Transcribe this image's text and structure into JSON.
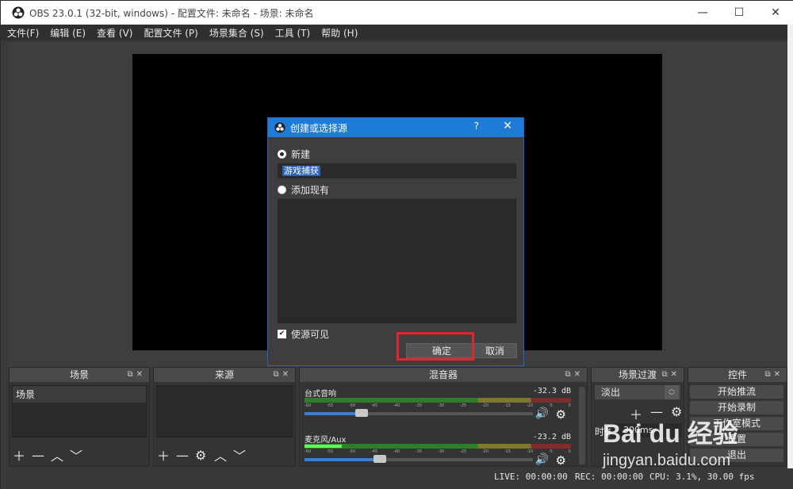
{
  "window": {
    "title": "OBS 23.0.1 (32-bit, windows) - 配置文件: 未命名 - 场景: 未命名",
    "controls": {
      "minimize": "—",
      "maximize": "☐",
      "close": "✕"
    }
  },
  "menu": [
    "文件(F)",
    "编辑 (E)",
    "查看 (V)",
    "配置文件 (P)",
    "场景集合 (S)",
    "工具 (T)",
    "帮助 (H)"
  ],
  "dialog": {
    "title": "创建或选择源",
    "help": "?",
    "close": "✕",
    "new_label": "新建",
    "name_value": "游戏捕获",
    "existing_label": "添加现有",
    "visible_label": "使源可见",
    "ok_label": "确定",
    "cancel_label": "取消"
  },
  "docks": {
    "scenes": {
      "title": "场景",
      "items": [
        "场景"
      ]
    },
    "sources": {
      "title": "来源"
    },
    "mixer": {
      "title": "混音器",
      "ticks": [
        "-60",
        "-55",
        "-50",
        "-45",
        "-40",
        "-35",
        "-30",
        "-25",
        "-20",
        "-15",
        "-10",
        "-5",
        "0"
      ],
      "tracks": [
        {
          "name": "台式音响",
          "db": "-32.3 dB",
          "volume": 0.25
        },
        {
          "name": "麦克风/Aux",
          "db": "-23.2 dB",
          "volume": 0.33
        }
      ]
    },
    "transitions": {
      "title": "场景过渡",
      "selected": "淡出",
      "duration_label": "时长",
      "duration_value": "300ms"
    },
    "controls": {
      "title": "控件",
      "buttons": [
        "开始推流",
        "开始录制",
        "工作室模式",
        "设置",
        "退出"
      ]
    }
  },
  "status": {
    "live": "LIVE: 00:00:00",
    "rec": "REC: 00:00:00",
    "cpu": "CPU: 3.1%, 30.00 fps"
  },
  "watermark": {
    "logo": "Bai du 经验",
    "url": "jingyan.baidu.com"
  }
}
